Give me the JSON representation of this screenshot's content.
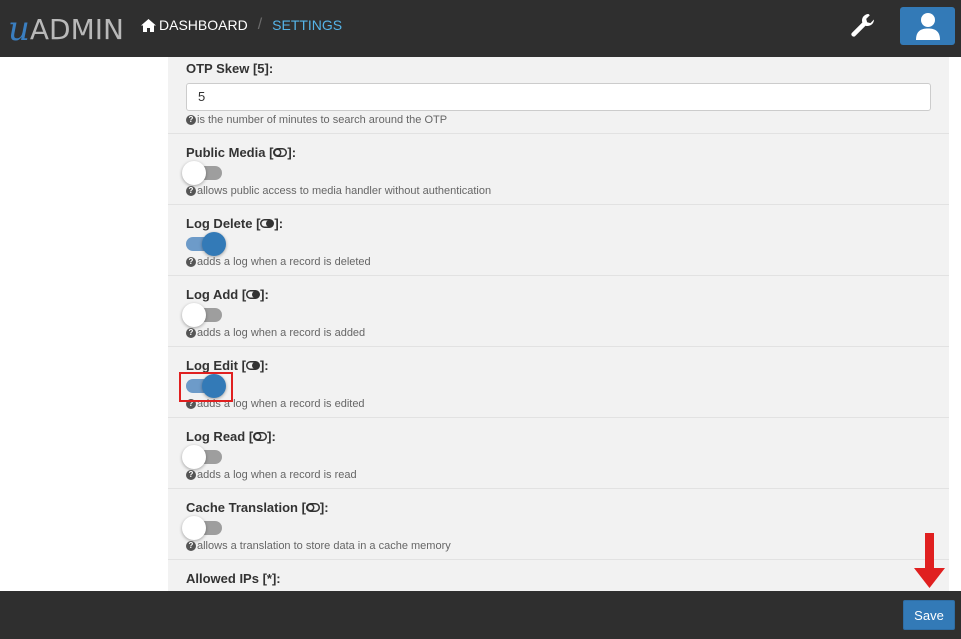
{
  "brand": {
    "prefix": "u",
    "name": "ADMIN"
  },
  "breadcrumb": {
    "home": "DASHBOARD",
    "separator": "/",
    "current": "SETTINGS"
  },
  "settings": [
    {
      "label": "OTP Skew [5]:",
      "type": "text",
      "value": "5",
      "help": "is the number of minutes to search around the OTP"
    },
    {
      "label_pre": "Public Media [",
      "label_post": "]:",
      "state": "off",
      "help": "allows public access to media handler without authentication"
    },
    {
      "label_pre": "Log Delete [",
      "label_post": "]:",
      "state": "on",
      "help": "adds a log when a record is deleted"
    },
    {
      "label_pre": "Log Add [",
      "label_post": "]:",
      "state": "off",
      "help": "adds a log when a record is added"
    },
    {
      "label_pre": "Log Edit [",
      "label_post": "]:",
      "state": "on",
      "help": "adds a log when a record is edited"
    },
    {
      "label_pre": "Log Read [",
      "label_post": "]:",
      "state": "off",
      "help": "adds a log when a record is read"
    },
    {
      "label_pre": "Cache Translation [",
      "label_post": "]:",
      "state": "off",
      "help": "allows a translation to store data in a cache memory"
    },
    {
      "label": "Allowed IPs [*]:"
    }
  ],
  "footer": {
    "save_label": "Save"
  },
  "colors": {
    "navbar": "#2f2f2f",
    "accent": "#337ab7",
    "link": "#55b4e8",
    "annotation": "#e02020"
  }
}
